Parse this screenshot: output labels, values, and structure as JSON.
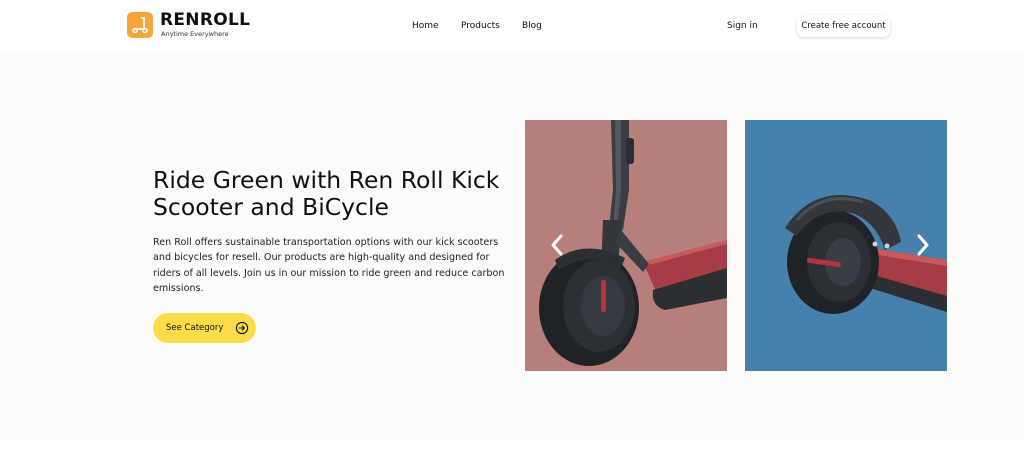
{
  "brand": {
    "name": "RENROLL",
    "tagline": "Anytime Everywhere",
    "logo_icon": "scooter-icon",
    "logo_color": "#f6a43c"
  },
  "nav": {
    "links": [
      "Home",
      "Products",
      "Blog"
    ],
    "sign_in": "Sign in",
    "create_account": "Create free account"
  },
  "hero": {
    "title": "Ride Green with Ren Roll Kick Scooter and BiCycle",
    "description": "Ren Roll offers sustainable transportation options with our kick scooters and bicycles for resell. Our products are high-quality and designed for riders of all levels. Join us in our mission to ride green and reduce carbon emissions.",
    "cta_label": "See Category",
    "cta_icon": "arrow-right-circle-icon",
    "cta_color": "#fbdc46"
  },
  "carousel": {
    "slides": [
      {
        "image": "kick-scooter-front-image",
        "background": "#b67f7a"
      },
      {
        "image": "kick-scooter-rear-wheel-image",
        "background": "#4581ab"
      }
    ],
    "prev_icon": "chevron-left-icon",
    "next_icon": "chevron-right-icon"
  }
}
